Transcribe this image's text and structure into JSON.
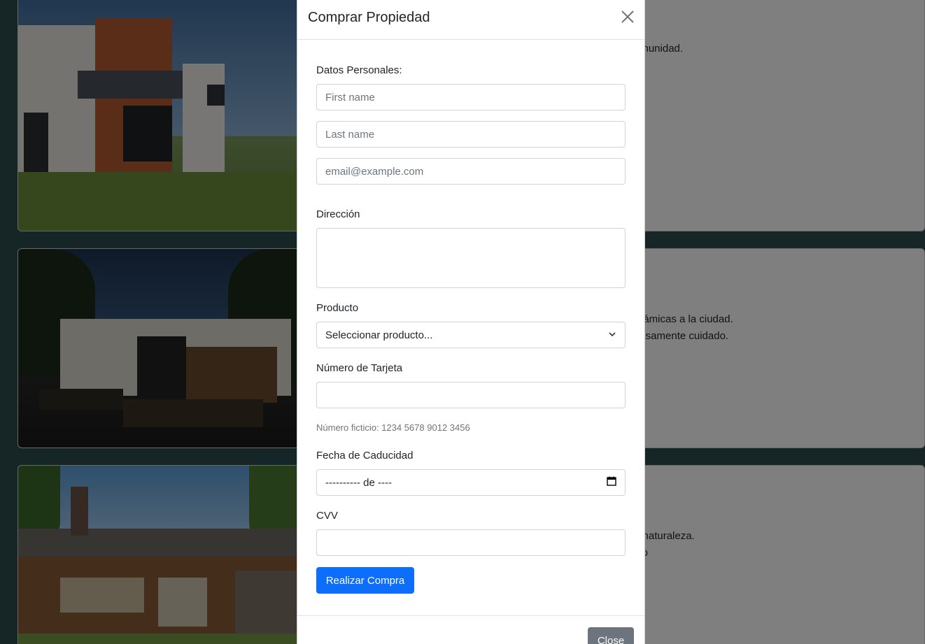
{
  "background_cards": [
    {
      "text_lines": [
        "omunidad."
      ]
    },
    {
      "text_lines": [
        "orámicas a la ciudad.",
        "dosamente cuidado."
      ]
    },
    {
      "text_lines": [
        "e naturaleza.",
        "ino"
      ]
    }
  ],
  "modal": {
    "title": "Comprar Propiedad",
    "close_icon": "close-icon",
    "personal_label": "Datos Personales:",
    "first_name_placeholder": "First name",
    "last_name_placeholder": "Last name",
    "email_placeholder": "email@example.com",
    "address_label": "Dirección",
    "product_label": "Producto",
    "product_selected": "Seleccionar producto...",
    "card_number_label": "Número de Tarjeta",
    "card_number_help": "Número ficticio: 1234 5678 9012 3456",
    "expiry_label": "Fecha de Caducidad",
    "expiry_value": "---------- de ----",
    "cvv_label": "CVV",
    "submit_label": "Realizar Compra",
    "close_label": "Close"
  }
}
